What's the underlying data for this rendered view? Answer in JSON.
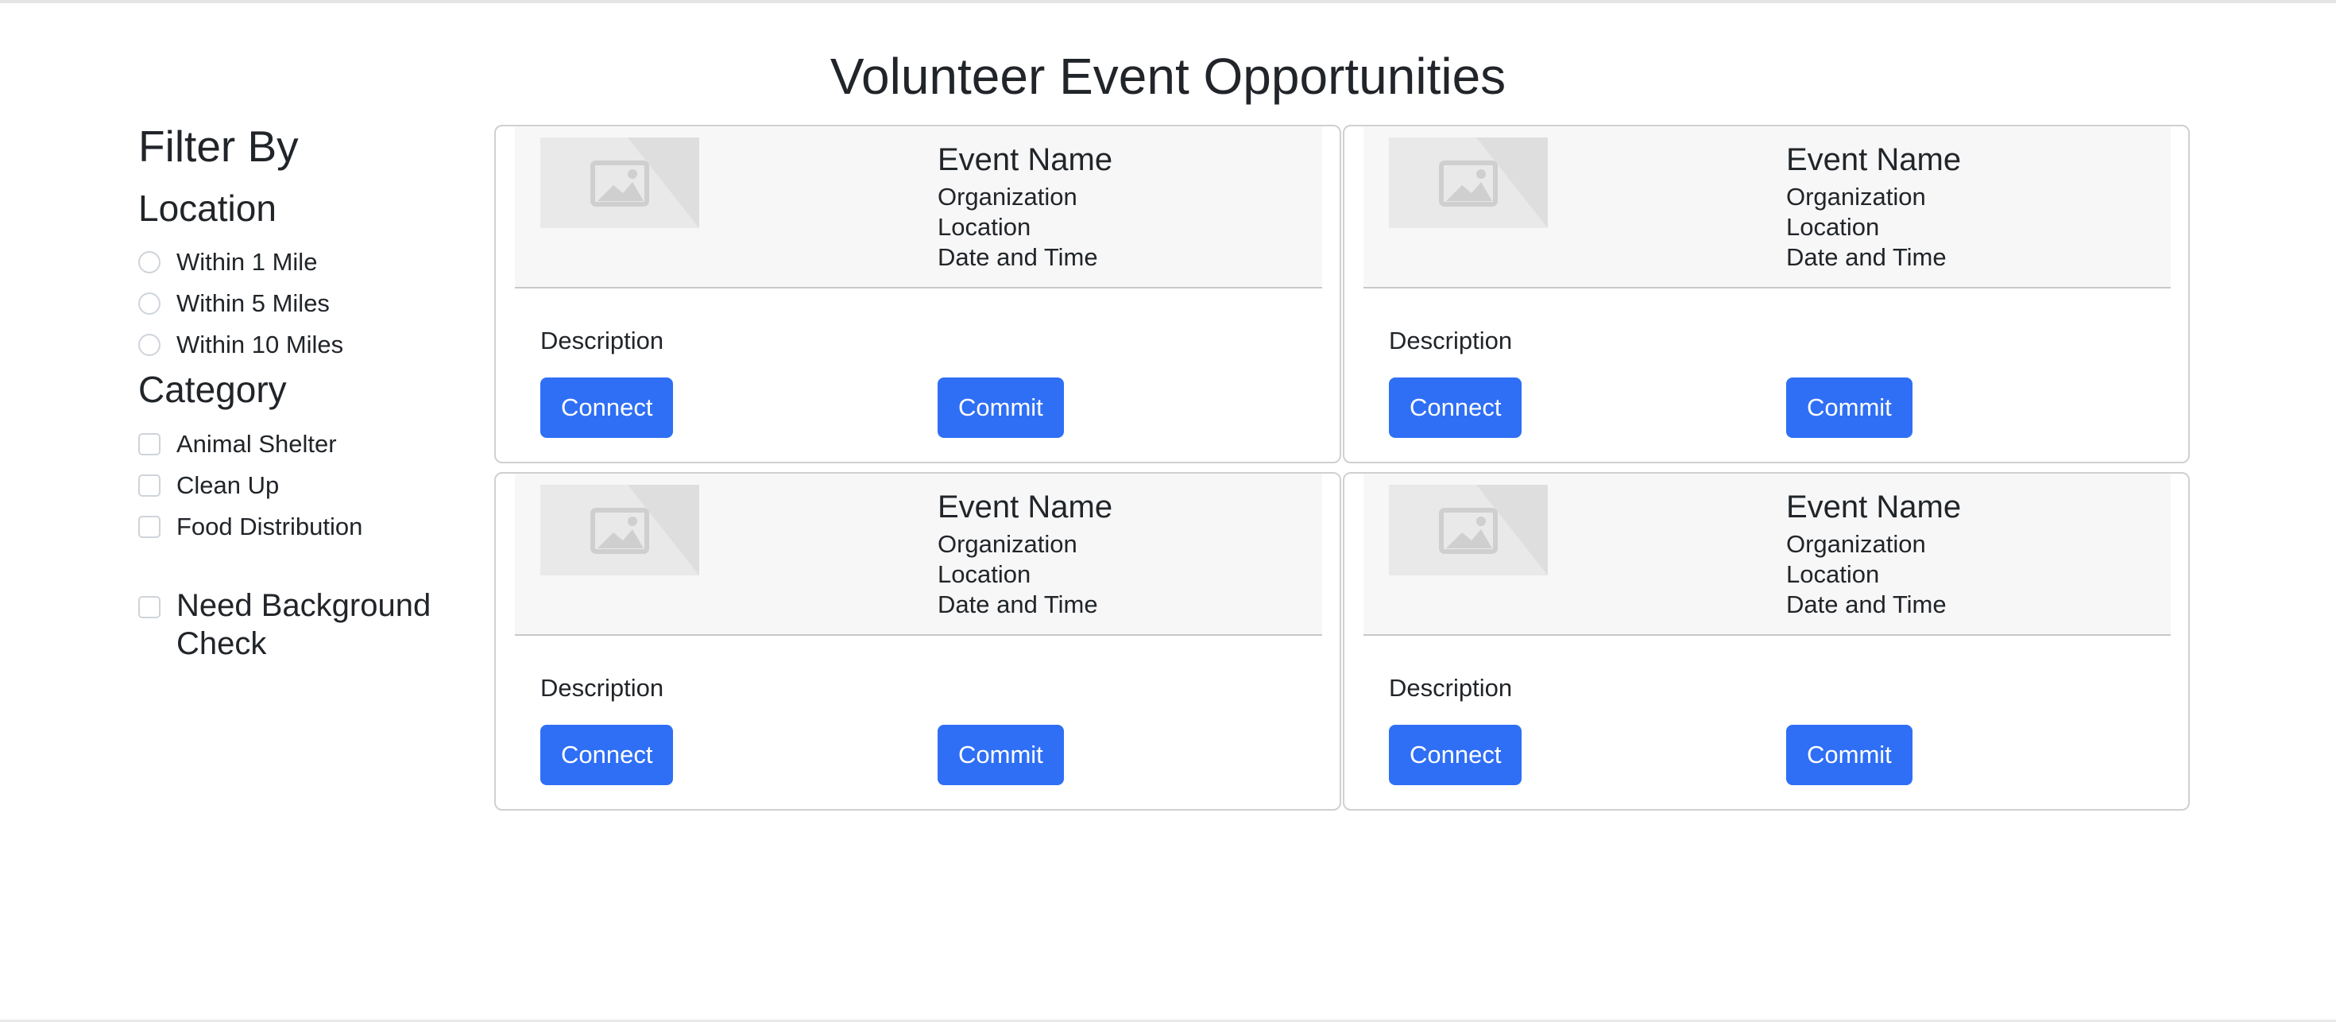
{
  "page": {
    "title": "Volunteer Event Opportunities"
  },
  "sidebar": {
    "heading": "Filter By",
    "location": {
      "heading": "Location",
      "options": [
        "Within 1 Mile",
        "Within 5 Miles",
        "Within 10 Miles"
      ]
    },
    "category": {
      "heading": "Category",
      "options": [
        "Animal Shelter",
        "Clean Up",
        "Food Distribution"
      ]
    },
    "background_check": "Need Background Check"
  },
  "events": [
    {
      "name": "Event Name",
      "organization": "Organization",
      "location": "Location",
      "datetime": "Date and Time",
      "description": "Description",
      "connect_label": "Connect",
      "commit_label": "Commit",
      "image_icon": "image-placeholder-icon"
    },
    {
      "name": "Event Name",
      "organization": "Organization",
      "location": "Location",
      "datetime": "Date and Time",
      "description": "Description",
      "connect_label": "Connect",
      "commit_label": "Commit",
      "image_icon": "image-placeholder-icon"
    },
    {
      "name": "Event Name",
      "organization": "Organization",
      "location": "Location",
      "datetime": "Date and Time",
      "description": "Description",
      "connect_label": "Connect",
      "commit_label": "Commit",
      "image_icon": "image-placeholder-icon"
    },
    {
      "name": "Event Name",
      "organization": "Organization",
      "location": "Location",
      "datetime": "Date and Time",
      "description": "Description",
      "connect_label": "Connect",
      "commit_label": "Commit",
      "image_icon": "image-placeholder-icon"
    }
  ],
  "colors": {
    "button": "#2f6ff5",
    "header_bg": "#f7f7f7",
    "text": "#212529"
  }
}
